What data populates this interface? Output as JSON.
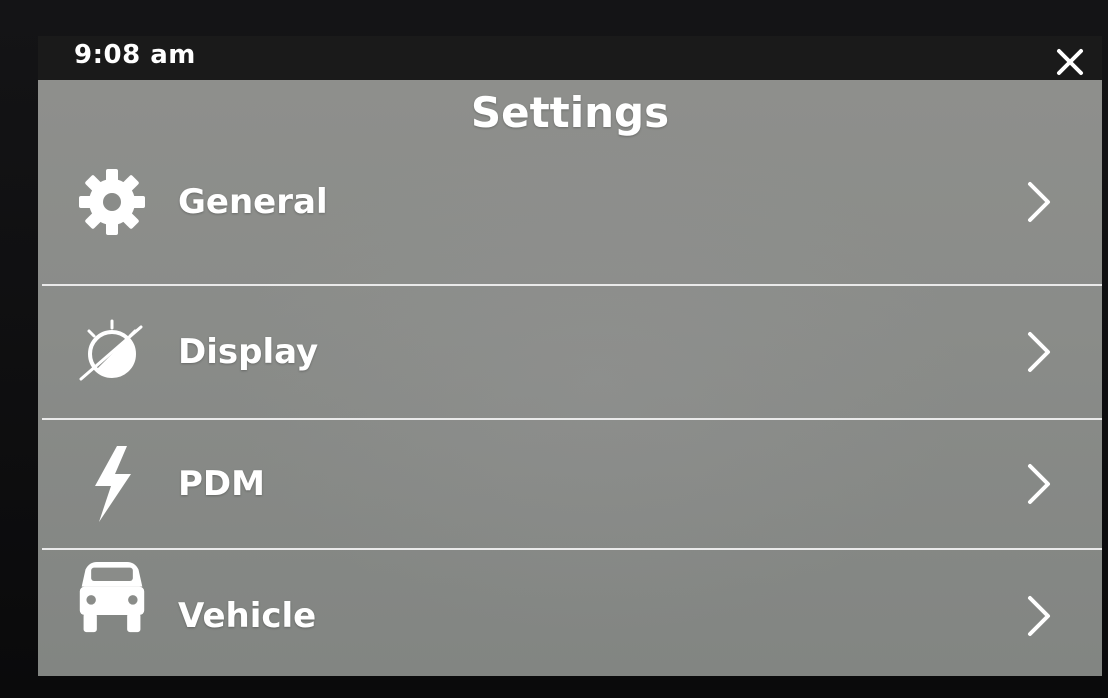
{
  "status": {
    "time": "9:08 am"
  },
  "header": {
    "title": "Settings"
  },
  "menu": {
    "items": [
      {
        "label": "General",
        "icon": "gear-icon"
      },
      {
        "label": "Display",
        "icon": "brightness-icon"
      },
      {
        "label": "PDM",
        "icon": "lightning-icon"
      },
      {
        "label": "Vehicle",
        "icon": "vehicle-icon"
      }
    ]
  },
  "colors": {
    "text": "#ffffff",
    "panel": "#8b8d8a",
    "divider": "#eaeaea",
    "bezel": "#0c0c0e"
  }
}
